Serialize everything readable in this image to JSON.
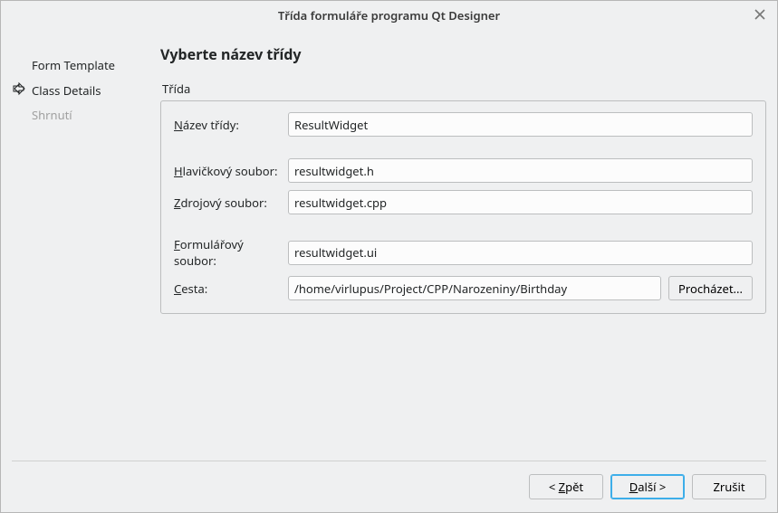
{
  "window": {
    "title": "Třída formuláře programu Qt Designer"
  },
  "sidebar": {
    "steps": [
      {
        "label": "Form Template"
      },
      {
        "label": "Class Details"
      },
      {
        "label": "Shrnutí"
      }
    ]
  },
  "main": {
    "heading": "Vyberte název třídy",
    "group_label": "Třída",
    "labels": {
      "class_name_pre": "N",
      "class_name_rest": "ázev třídy:",
      "header_pre": "H",
      "header_rest": "lavičkový soubor:",
      "source_pre": "Z",
      "source_rest": "drojový soubor:",
      "form_pre": "F",
      "form_rest": "ormulářový soubor:",
      "path_pre": "C",
      "path_rest": "esta:"
    },
    "values": {
      "class_name": "ResultWidget",
      "header_file": "resultwidget.h",
      "source_file": "resultwidget.cpp",
      "form_file": "resultwidget.ui",
      "path": "/home/virlupus/Project/CPP/Narozeniny/Birthday"
    },
    "browse_label": "Procházet..."
  },
  "footer": {
    "back_pre": "< ",
    "back_ul": "Z",
    "back_rest": "pět",
    "next_ul": "D",
    "next_rest": "alší >",
    "cancel": "Zrušit"
  }
}
